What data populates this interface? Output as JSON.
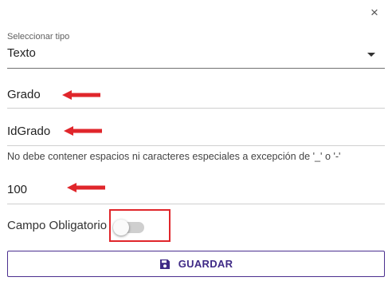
{
  "dialog": {
    "close_glyph": "×"
  },
  "type_select": {
    "label": "Seleccionar tipo",
    "value": "Texto"
  },
  "fields": {
    "nombre": "Grado",
    "id": "IdGrado",
    "helper": "No debe contener espacios ni caracteres especiales a excepción de '_' o '-'",
    "valor": "100"
  },
  "required_toggle": {
    "label": "Campo Obligatorio",
    "checked": false
  },
  "save_button": {
    "label": "GUARDAR",
    "icon": "save-icon"
  },
  "colors": {
    "accent": "#3f2a86",
    "annotation": "#e0262b"
  }
}
